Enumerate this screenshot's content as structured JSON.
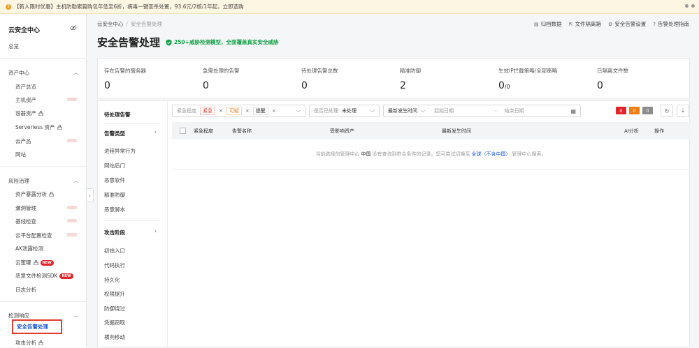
{
  "banner": {
    "text": "【新人限时优惠】主机防勒索篇购包年低至6折，病毒一键查杀处置，93.6元/2核/1年起，立即选购"
  },
  "sidebar": {
    "title": "云安全中心",
    "overview": "总览",
    "groups": [
      {
        "label": "资产中心",
        "items": [
          "资产总览",
          "主机资产",
          "容器资产",
          "Serverless 资产",
          "云产品",
          "网站"
        ]
      },
      {
        "label": "风险治理",
        "items": [
          "资产暴露分析",
          "漏洞管理",
          "基线检查",
          "云平台配置检查",
          "AK泄露检测",
          "云蜜罐",
          "恶意文件检测SDK",
          "日志分析"
        ]
      },
      {
        "label": "检测响应",
        "items": [
          "安全告警处理",
          "攻击分析"
        ]
      }
    ],
    "new_badge": "NEW"
  },
  "breadcrumb": {
    "root": "云安全中心",
    "sep": "/",
    "current": "安全告警处理"
  },
  "toplinks": [
    "归档数据",
    "文件隔离箱",
    "安全告警设置",
    "告警处理指南"
  ],
  "page": {
    "title": "安全告警处理",
    "tag": "250+威胁检测模型，全面覆盖真实安全威胁"
  },
  "stats": [
    {
      "label": "存在告警的服务器",
      "value": "0"
    },
    {
      "label": "急需处理的告警",
      "value": "0"
    },
    {
      "label": "待处理告警总数",
      "value": "0"
    },
    {
      "label": "精准防御",
      "value": "2"
    },
    {
      "label": "生效IP拦截策略/全部策略",
      "value": "0",
      "suffix": "/0"
    },
    {
      "label": "已隔离文件数",
      "value": "0"
    }
  ],
  "subnav": {
    "pending": "待处理告警",
    "type_header": "告警类型",
    "types": [
      "进程异常行为",
      "网站后门",
      "恶意软件",
      "精准防御",
      "恶意脚本"
    ],
    "stage_header": "攻击阶段",
    "stages": [
      "初始入口",
      "代码执行",
      "持久化",
      "权限提升",
      "防御绕过",
      "凭据窃取",
      "横向移动"
    ]
  },
  "filters": {
    "severity_label": "紧急程度",
    "urgent": "紧急",
    "suspicious": "可疑",
    "hint": "提醒",
    "handled_label": "是否已处理",
    "handled_value": "未处理",
    "sort_label": "最新发生时间",
    "start_placeholder": "起始日期",
    "date_sep": "-",
    "end_placeholder": "结束日期"
  },
  "badges": [
    {
      "value": "0",
      "color": "#e3242b"
    },
    {
      "value": "0",
      "color": "#f07d12"
    },
    {
      "value": "0",
      "color": "#8c8c8c"
    }
  ],
  "table": {
    "columns": [
      "紧急程度",
      "告警名称",
      "受影响资产",
      "最新发生时间",
      "AI分析",
      "操作"
    ],
    "empty_pre": "当前选择的管理中心",
    "empty_region": "中国",
    "empty_mid": "没有查询到符合条件的记录。您可尝试切换至",
    "empty_link": "全球（不含中国）",
    "empty_post": "管理中心搜索。"
  }
}
